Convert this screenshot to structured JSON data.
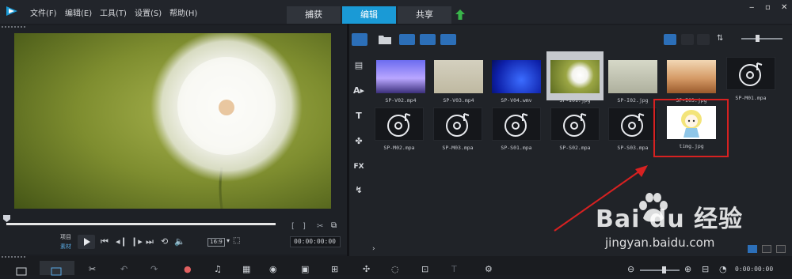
{
  "menu": {
    "file": "文件(F)",
    "edit": "编辑(E)",
    "tools": "工具(T)",
    "settings": "设置(S)",
    "help": "帮助(H)"
  },
  "tabs": {
    "capture": "捕获",
    "edit": "编辑",
    "share": "共享",
    "active": "编辑"
  },
  "player": {
    "project_label": "项目",
    "clip_label": "素材",
    "aspect": "16:9",
    "timecode": "00:00:00:00"
  },
  "library": {
    "items": [
      {
        "label": "SP-V02.mp4",
        "kind": "video"
      },
      {
        "label": "SP-V03.mp4",
        "kind": "video"
      },
      {
        "label": "SP-V04.wmv",
        "kind": "video"
      },
      {
        "label": "SP-I01.jpg",
        "kind": "image",
        "selected": true
      },
      {
        "label": "SP-I02.jpg",
        "kind": "image"
      },
      {
        "label": "SP-I03.jpg",
        "kind": "image"
      },
      {
        "label": "SP-M01.mpa",
        "kind": "audio"
      },
      {
        "label": "SP-M02.mpa",
        "kind": "audio"
      },
      {
        "label": "SP-M03.mpa",
        "kind": "audio"
      },
      {
        "label": "SP-S01.mpa",
        "kind": "audio"
      },
      {
        "label": "SP-S02.mpa",
        "kind": "audio"
      },
      {
        "label": "SP-S03.mpa",
        "kind": "audio"
      },
      {
        "label": "timg.jpg",
        "kind": "image",
        "highlighted": true
      }
    ]
  },
  "timeline": {
    "timecode": "0:00:00:00"
  },
  "watermark": {
    "brand": "Bai du 经验",
    "url": "jingyan.baidu.com"
  },
  "colors": {
    "accent": "#1a9ad6",
    "highlight": "#d72121"
  }
}
